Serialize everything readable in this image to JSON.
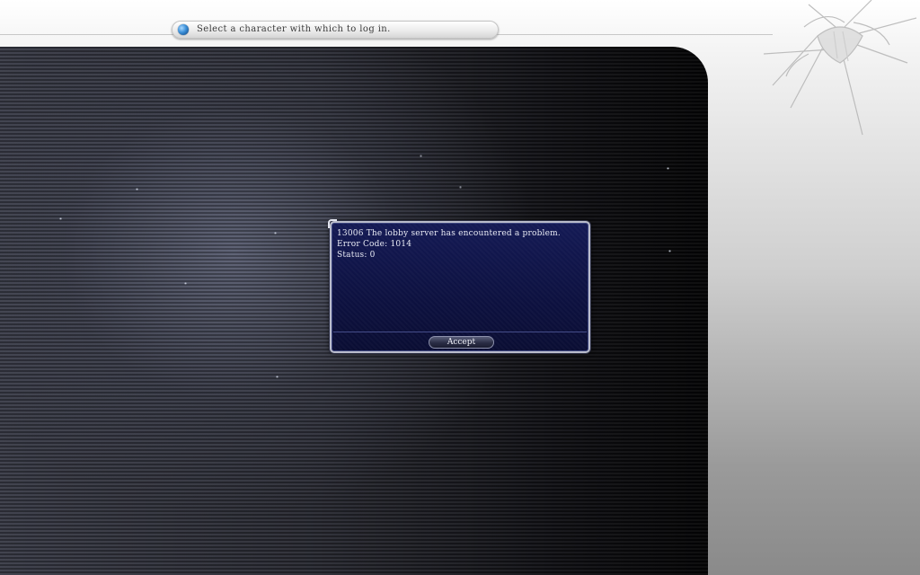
{
  "prompt": {
    "text": "Select a character with which to log in.",
    "icon": "blue-orb-icon"
  },
  "dialog": {
    "lines": [
      "13006 The lobby server has encountered a problem.",
      "Error Code: 1014",
      "Status: 0"
    ],
    "accept_label": "Accept"
  },
  "colors": {
    "dialog_background": "#0d1140",
    "dialog_border": "#b9bccb",
    "panel_dark": "#101014",
    "backdrop_light": "#f3f3f3"
  }
}
